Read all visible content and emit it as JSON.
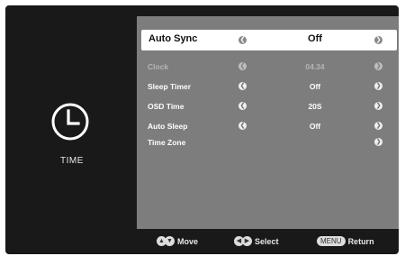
{
  "section": {
    "title": "TIME",
    "icon": "clock-icon"
  },
  "menu": {
    "rows": [
      {
        "label": "Auto Sync",
        "value": "Off"
      },
      {
        "label": "Clock",
        "value": "04.34"
      },
      {
        "label": "Sleep Timer",
        "value": "Off"
      },
      {
        "label": "OSD Time",
        "value": "20S"
      },
      {
        "label": "Auto Sleep",
        "value": "Off"
      },
      {
        "label": "Time Zone",
        "value": ""
      }
    ]
  },
  "footer": {
    "move_label": "Move",
    "select_label": "Select",
    "menu_key": "MENU",
    "return_label": "Return"
  },
  "colors": {
    "screen_bg": "#191919",
    "menu_bg": "#7d7d7d",
    "highlight": "#ffffff",
    "disabled_text": "#b4b4b4"
  }
}
